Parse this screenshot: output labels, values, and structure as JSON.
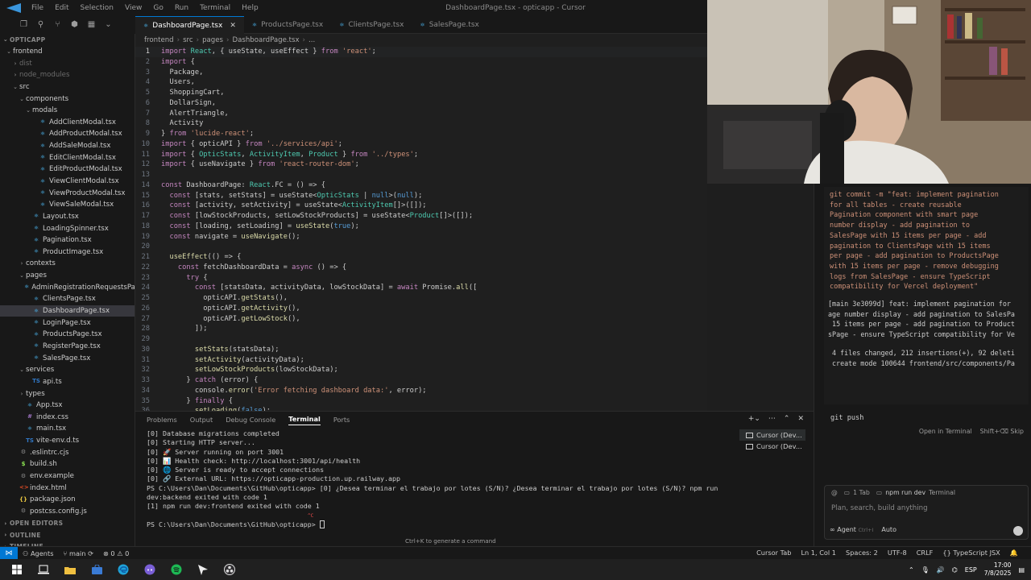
{
  "window": {
    "title": "DashboardPage.tsx - opticapp - Cursor",
    "menu": [
      "File",
      "Edit",
      "Selection",
      "View",
      "Go",
      "Run",
      "Terminal",
      "Help"
    ]
  },
  "tabs": [
    {
      "label": "DashboardPage.tsx",
      "active": true
    },
    {
      "label": "ProductsPage.tsx",
      "active": false
    },
    {
      "label": "ClientsPage.tsx",
      "active": false
    },
    {
      "label": "SalesPage.tsx",
      "active": false
    }
  ],
  "breadcrumb": [
    "frontend",
    "src",
    "pages",
    "DashboardPage.tsx",
    "..."
  ],
  "explorer": {
    "root": "OPTICAPP",
    "tree": [
      {
        "label": "frontend",
        "indent": 1,
        "type": "folder-open"
      },
      {
        "label": "dist",
        "indent": 2,
        "type": "folder",
        "dim": true
      },
      {
        "label": "node_modules",
        "indent": 2,
        "type": "folder",
        "dim": true
      },
      {
        "label": "src",
        "indent": 2,
        "type": "folder-open"
      },
      {
        "label": "components",
        "indent": 3,
        "type": "folder-open"
      },
      {
        "label": "modals",
        "indent": 4,
        "type": "folder-open"
      },
      {
        "label": "AddClientModal.tsx",
        "indent": 5,
        "type": "tsx"
      },
      {
        "label": "AddProductModal.tsx",
        "indent": 5,
        "type": "tsx"
      },
      {
        "label": "AddSaleModal.tsx",
        "indent": 5,
        "type": "tsx"
      },
      {
        "label": "EditClientModal.tsx",
        "indent": 5,
        "type": "tsx"
      },
      {
        "label": "EditProductModal.tsx",
        "indent": 5,
        "type": "tsx"
      },
      {
        "label": "ViewClientModal.tsx",
        "indent": 5,
        "type": "tsx"
      },
      {
        "label": "ViewProductModal.tsx",
        "indent": 5,
        "type": "tsx"
      },
      {
        "label": "ViewSaleModal.tsx",
        "indent": 5,
        "type": "tsx"
      },
      {
        "label": "Layout.tsx",
        "indent": 4,
        "type": "tsx"
      },
      {
        "label": "LoadingSpinner.tsx",
        "indent": 4,
        "type": "tsx"
      },
      {
        "label": "Pagination.tsx",
        "indent": 4,
        "type": "tsx"
      },
      {
        "label": "ProductImage.tsx",
        "indent": 4,
        "type": "tsx"
      },
      {
        "label": "contexts",
        "indent": 3,
        "type": "folder"
      },
      {
        "label": "pages",
        "indent": 3,
        "type": "folder-open"
      },
      {
        "label": "AdminRegistrationRequestsPag...",
        "indent": 4,
        "type": "tsx"
      },
      {
        "label": "ClientsPage.tsx",
        "indent": 4,
        "type": "tsx"
      },
      {
        "label": "DashboardPage.tsx",
        "indent": 4,
        "type": "tsx",
        "selected": true
      },
      {
        "label": "LoginPage.tsx",
        "indent": 4,
        "type": "tsx"
      },
      {
        "label": "ProductsPage.tsx",
        "indent": 4,
        "type": "tsx"
      },
      {
        "label": "RegisterPage.tsx",
        "indent": 4,
        "type": "tsx"
      },
      {
        "label": "SalesPage.tsx",
        "indent": 4,
        "type": "tsx"
      },
      {
        "label": "services",
        "indent": 3,
        "type": "folder-open"
      },
      {
        "label": "api.ts",
        "indent": 4,
        "type": "ts"
      },
      {
        "label": "types",
        "indent": 3,
        "type": "folder"
      },
      {
        "label": "App.tsx",
        "indent": 3,
        "type": "tsx"
      },
      {
        "label": "index.css",
        "indent": 3,
        "type": "css"
      },
      {
        "label": "main.tsx",
        "indent": 3,
        "type": "tsx"
      },
      {
        "label": "vite-env.d.ts",
        "indent": 3,
        "type": "ts"
      },
      {
        "label": ".eslintrc.cjs",
        "indent": 2,
        "type": "gen"
      },
      {
        "label": "build.sh",
        "indent": 2,
        "type": "sh"
      },
      {
        "label": "env.example",
        "indent": 2,
        "type": "gen"
      },
      {
        "label": "index.html",
        "indent": 2,
        "type": "html"
      },
      {
        "label": "package.json",
        "indent": 2,
        "type": "json"
      },
      {
        "label": "postcss.config.js",
        "indent": 2,
        "type": "gen"
      }
    ],
    "sections": [
      "OPEN EDITORS",
      "OUTLINE",
      "TIMELINE"
    ]
  },
  "editor": {
    "current_line": 1,
    "lines": [
      "import React, { useState, useEffect } from 'react';",
      "import {",
      "  Package,",
      "  Users,",
      "  ShoppingCart,",
      "  DollarSign,",
      "  AlertTriangle,",
      "  Activity",
      "} from 'lucide-react';",
      "import { opticAPI } from '../services/api';",
      "import { OpticStats, ActivityItem, Product } from '../types';",
      "import { useNavigate } from 'react-router-dom';",
      "",
      "const DashboardPage: React.FC = () => {",
      "  const [stats, setStats] = useState<OpticStats | null>(null);",
      "  const [activity, setActivity] = useState<ActivityItem[]>([]);",
      "  const [lowStockProducts, setLowStockProducts] = useState<Product[]>([]);",
      "  const [loading, setLoading] = useState(true);",
      "  const navigate = useNavigate();",
      "",
      "  useEffect(() => {",
      "    const fetchDashboardData = async () => {",
      "      try {",
      "        const [statsData, activityData, lowStockData] = await Promise.all([",
      "          opticAPI.getStats(),",
      "          opticAPI.getActivity(),",
      "          opticAPI.getLowStock(),",
      "        ]);",
      "",
      "        setStats(statsData);",
      "        setActivity(activityData);",
      "        setLowStockProducts(lowStockData);",
      "      } catch (error) {",
      "        console.error('Error fetching dashboard data:', error);",
      "      } finally {",
      "        setLoading(false);"
    ]
  },
  "panel": {
    "tabs": [
      "Problems",
      "Output",
      "Debug Console",
      "Terminal",
      "Ports"
    ],
    "active_tab": "Terminal",
    "terminal_lines": [
      "[0] Database migrations completed",
      "[0] Starting HTTP server...",
      "[0] 🚀 Server running on port 3001",
      "[0] 📊 Health check: http://localhost:3001/api/health",
      "[0] 🌐 Server is ready to accept connections",
      "[0] 🔗 External URL: https://opticapp-production.up.railway.app",
      "PS C:\\Users\\Dan\\Documents\\GitHub\\opticapp> [0] ¿Desea terminar el trabajo por lotes (S/N)? ¿Desea terminar el trabajo por lotes (S/N)? npm run dev:backend exited with code 1",
      "[1] npm run dev:frontend exited with code 1"
    ],
    "ctrl_c": "^C",
    "prompt": "PS C:\\Users\\Dan\\Documents\\GitHub\\opticapp> ",
    "hint": "Ctrl+K to generate a command",
    "terminal_instances": [
      "Cursor (Dev...",
      "Cursor (Dev..."
    ]
  },
  "chat": {
    "commit_command": "git commit -m \"feat: implement pagination for all tables - create reusable Pagination component with smart page number display - add pagination to SalesPage with 15 items per page - add pagination to ClientsPage with 15 items per page - add pagination to ProductsPage with 15 items per page - remove debugging logs from SalesPage - ensure TypeScript compatibility for Vercel deployment\"",
    "output_lines": [
      "[main 3e3099d] feat: implement pagination for",
      "age number display - add pagination to SalesPa",
      " 15 items per page - add pagination to Product",
      "sPage - ensure TypeScript compatibility for Ve"
    ],
    "stats_lines": [
      "4 files changed, 212 insertions(+), 92 deleti",
      "create mode 100644 frontend/src/components/Pa"
    ],
    "next_command": "git push",
    "open_in_terminal": "Open in Terminal",
    "skip": "Shift+⌫ Skip",
    "context_tab": "1 Tab",
    "context_terminal": "npm run dev",
    "context_terminal_label": "Terminal",
    "placeholder": "Plan, search, build anything",
    "agent_label": "Agent",
    "agent_kbd": "Ctrl+I",
    "auto_label": "Auto"
  },
  "statusbar": {
    "agents": "Agents",
    "branch": "main",
    "problems": "⊗ 0 ⚠ 0",
    "right": [
      "Cursor Tab",
      "Ln 1, Col 1",
      "Spaces: 2",
      "UTF-8",
      "CRLF",
      "{} TypeScript JSX"
    ]
  },
  "taskbar": {
    "language": "ESP",
    "time": "17:00",
    "date": "7/8/2025"
  }
}
